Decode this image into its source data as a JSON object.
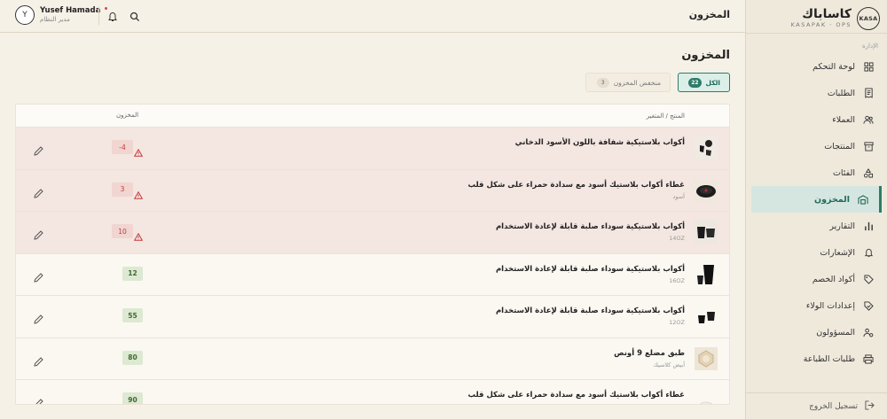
{
  "brand": {
    "badge": "KASA",
    "name": "كاساباك",
    "sub": "KASAPAK · OPS"
  },
  "sidebar": {
    "section_label": "الإدارة",
    "items": [
      {
        "label": "لوحة التحكم",
        "icon": "grid-icon"
      },
      {
        "label": "الطلبات",
        "icon": "receipt-icon"
      },
      {
        "label": "العملاء",
        "icon": "users-icon"
      },
      {
        "label": "المنتجات",
        "icon": "box-icon"
      },
      {
        "label": "الفئات",
        "icon": "shapes-icon"
      },
      {
        "label": "المخزون",
        "icon": "warehouse-icon",
        "active": true
      },
      {
        "label": "التقارير",
        "icon": "bar-chart-icon"
      },
      {
        "label": "الإشعارات",
        "icon": "bell-icon"
      },
      {
        "label": "أكواد الخصم",
        "icon": "tag-icon"
      },
      {
        "label": "إعدادات الولاء",
        "icon": "loyalty-tag-icon"
      },
      {
        "label": "المسؤولون",
        "icon": "admin-users-icon"
      },
      {
        "label": "طلبات الطباعة",
        "icon": "printer-icon"
      }
    ],
    "logout": "تسجيل الخروج"
  },
  "topbar": {
    "title": "المخزون",
    "user_initial": "Y",
    "user_name": "Yusef Hamada",
    "user_role": "مدير النظام"
  },
  "main": {
    "title": "المخزون",
    "tabs": [
      {
        "label": "الكل",
        "count": "22",
        "active": true
      },
      {
        "label": "منخفض المخزون",
        "count": "3",
        "active": false
      }
    ],
    "columns": {
      "product": "المنتج / المتغير",
      "stock": "المخزون"
    },
    "rows": [
      {
        "name": "أكواب بلاستيكية شفافة باللون الأسود الدخاني",
        "variant": "",
        "stock": "-4",
        "status": "neg"
      },
      {
        "name": "غطاء أكواب بلاستيك أسود مع سدادة حمراء على شكل قلب",
        "variant": "أسود",
        "stock": "3",
        "status": "warn"
      },
      {
        "name": "أكواب بلاستيكية سوداء صلبة قابلة لإعادة الاستخدام",
        "variant": "14OZ",
        "stock": "10",
        "status": "warn"
      },
      {
        "name": "أكواب بلاستيكية سوداء صلبة قابلة لإعادة الاستخدام",
        "variant": "16OZ",
        "stock": "12",
        "status": "ok"
      },
      {
        "name": "أكواب بلاستيكية سوداء صلبة قابلة لإعادة الاستخدام",
        "variant": "12OZ",
        "stock": "55",
        "status": "ok"
      },
      {
        "name": "طبق مضلع 9 أونص",
        "variant": "أبيض كلاسيك",
        "stock": "80",
        "status": "ok"
      },
      {
        "name": "غطاء أكواب بلاستيك أسود مع سدادة حمراء على شكل قلب",
        "variant": "",
        "stock": "90",
        "status": "ok"
      }
    ]
  },
  "colors": {
    "accent": "#2c7c69",
    "danger": "#c23b3b",
    "ok": "#3d6b2a",
    "background": "#f6f1e7"
  }
}
